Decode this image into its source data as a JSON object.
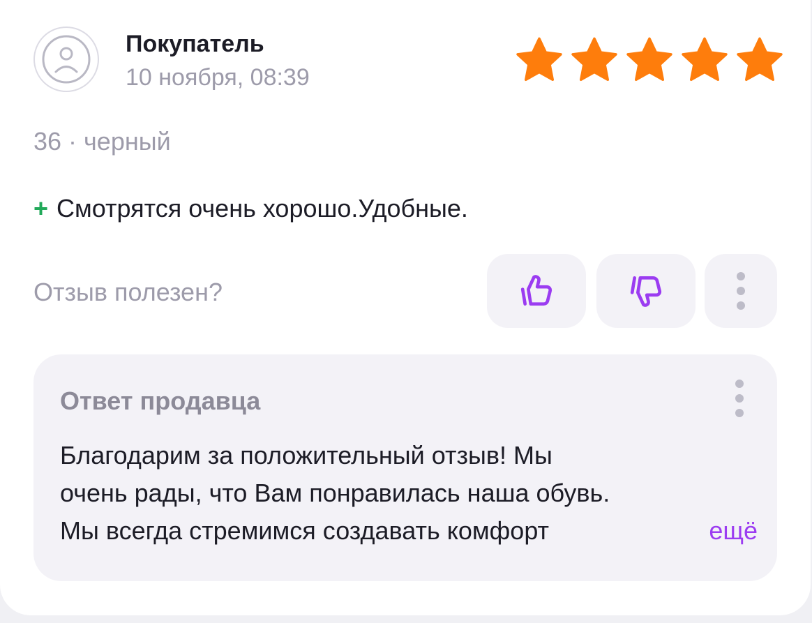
{
  "review": {
    "author": "Покупатель",
    "date": "10 ноября, 08:39",
    "rating": 5,
    "rating_max": 5,
    "variant": "36 · черный",
    "pros_prefix": "+",
    "pros_text": "Смотрятся очень хорошо.Удобные."
  },
  "helpful": {
    "question": "Отзыв полезен?",
    "like_icon": "thumbs-up-icon",
    "dislike_icon": "thumbs-down-icon",
    "more_icon": "more-vertical-icon"
  },
  "seller_reply": {
    "title": "Ответ продавца",
    "lines": [
      "Благодарим за положительный отзыв! Мы",
      "очень рады, что Вам понравилась наша обувь.",
      "Мы всегда стремимся создавать комфорт"
    ],
    "more_label": "ещё"
  },
  "colors": {
    "star": "#fe7d0c",
    "accent": "#9b3cf1",
    "positive": "#22a95a",
    "muted": "#9d9baa"
  }
}
